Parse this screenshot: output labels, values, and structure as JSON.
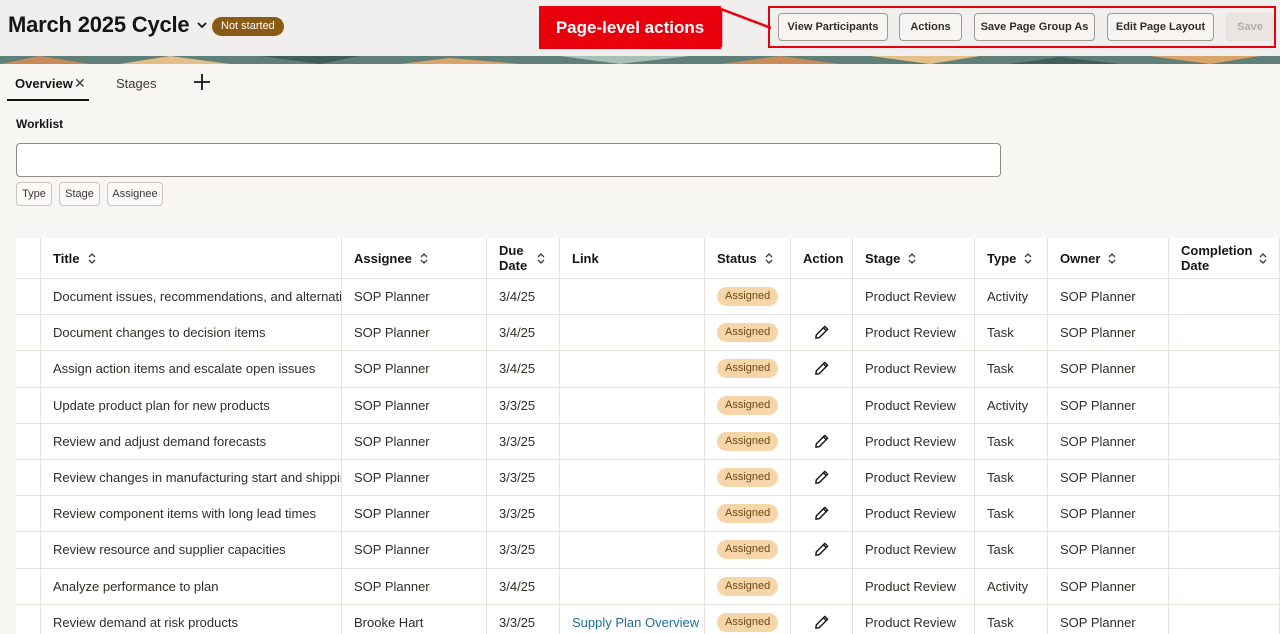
{
  "header": {
    "title": "March 2025 Cycle",
    "status": "Not started",
    "annotation": "Page-level actions",
    "buttons": {
      "view_participants": "View Participants",
      "actions": "Actions",
      "save_page_group_as": "Save Page Group As",
      "edit_page_layout": "Edit Page Layout",
      "save": "Save"
    }
  },
  "tabs": {
    "overview": "Overview",
    "stages": "Stages"
  },
  "worklist": {
    "title": "Worklist",
    "search_value": "",
    "filters": [
      "Type",
      "Stage",
      "Assignee"
    ]
  },
  "table": {
    "columns": [
      "Title",
      "Assignee",
      "Due Date",
      "Link",
      "Status",
      "Action",
      "Stage",
      "Type",
      "Owner",
      "Completion Date"
    ],
    "rows": [
      {
        "title": "Document issues, recommendations, and alternatives",
        "assignee": "SOP Planner",
        "due": "3/4/25",
        "link": "",
        "status": "Assigned",
        "action": false,
        "stage": "Product Review",
        "type": "Activity",
        "owner": "SOP Planner",
        "completion": ""
      },
      {
        "title": "Document changes to decision items",
        "assignee": "SOP Planner",
        "due": "3/4/25",
        "link": "",
        "status": "Assigned",
        "action": true,
        "stage": "Product Review",
        "type": "Task",
        "owner": "SOP Planner",
        "completion": ""
      },
      {
        "title": "Assign action items and escalate open issues",
        "assignee": "SOP Planner",
        "due": "3/4/25",
        "link": "",
        "status": "Assigned",
        "action": true,
        "stage": "Product Review",
        "type": "Task",
        "owner": "SOP Planner",
        "completion": ""
      },
      {
        "title": "Update product plan for new products",
        "assignee": "SOP Planner",
        "due": "3/3/25",
        "link": "",
        "status": "Assigned",
        "action": false,
        "stage": "Product Review",
        "type": "Activity",
        "owner": "SOP Planner",
        "completion": ""
      },
      {
        "title": "Review and adjust demand forecasts",
        "assignee": "SOP Planner",
        "due": "3/3/25",
        "link": "",
        "status": "Assigned",
        "action": true,
        "stage": "Product Review",
        "type": "Task",
        "owner": "SOP Planner",
        "completion": ""
      },
      {
        "title": "Review changes in manufacturing start and shipping",
        "assignee": "SOP Planner",
        "due": "3/3/25",
        "link": "",
        "status": "Assigned",
        "action": true,
        "stage": "Product Review",
        "type": "Task",
        "owner": "SOP Planner",
        "completion": ""
      },
      {
        "title": "Review component items with long lead times",
        "assignee": "SOP Planner",
        "due": "3/3/25",
        "link": "",
        "status": "Assigned",
        "action": true,
        "stage": "Product Review",
        "type": "Task",
        "owner": "SOP Planner",
        "completion": ""
      },
      {
        "title": "Review resource and supplier capacities",
        "assignee": "SOP Planner",
        "due": "3/3/25",
        "link": "",
        "status": "Assigned",
        "action": true,
        "stage": "Product Review",
        "type": "Task",
        "owner": "SOP Planner",
        "completion": ""
      },
      {
        "title": "Analyze performance to plan",
        "assignee": "SOP Planner",
        "due": "3/4/25",
        "link": "",
        "status": "Assigned",
        "action": false,
        "stage": "Product Review",
        "type": "Activity",
        "owner": "SOP Planner",
        "completion": ""
      },
      {
        "title": "Review demand at risk products",
        "assignee": "Brooke Hart",
        "due": "3/3/25",
        "link": "Supply Plan Overview",
        "status": "Assigned",
        "action": true,
        "stage": "Product Review",
        "type": "Task",
        "owner": "SOP Planner",
        "completion": ""
      }
    ]
  },
  "colors": {
    "annotation_red": "#e8000c",
    "status_pill": "#8b5a14",
    "assigned_badge": "#f6d6a9",
    "link": "#1f6f9a"
  }
}
